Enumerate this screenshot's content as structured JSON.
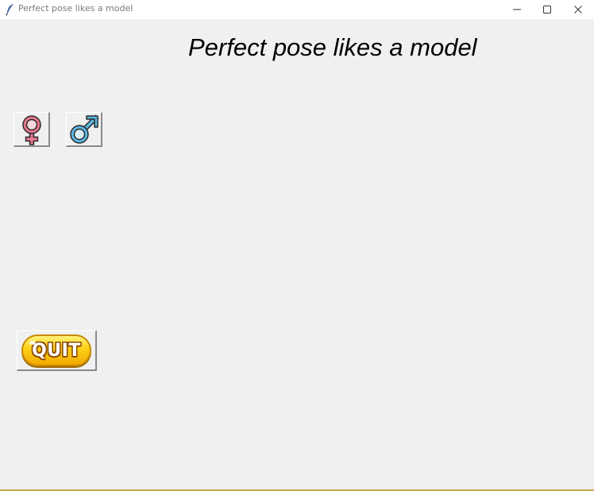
{
  "window": {
    "title": "Perfect pose likes a model",
    "controls": {
      "minimize_icon": "minimize-icon",
      "maximize_icon": "maximize-icon",
      "close_icon": "close-icon"
    }
  },
  "main": {
    "heading": "Perfect pose likes a model",
    "gender_buttons": [
      {
        "icon": "female-symbol-icon",
        "color": "#e8788f"
      },
      {
        "icon": "male-symbol-icon",
        "color": "#5bb8e0"
      }
    ],
    "quit_button": {
      "label": "QUIT",
      "color": "#ffd21a"
    }
  }
}
